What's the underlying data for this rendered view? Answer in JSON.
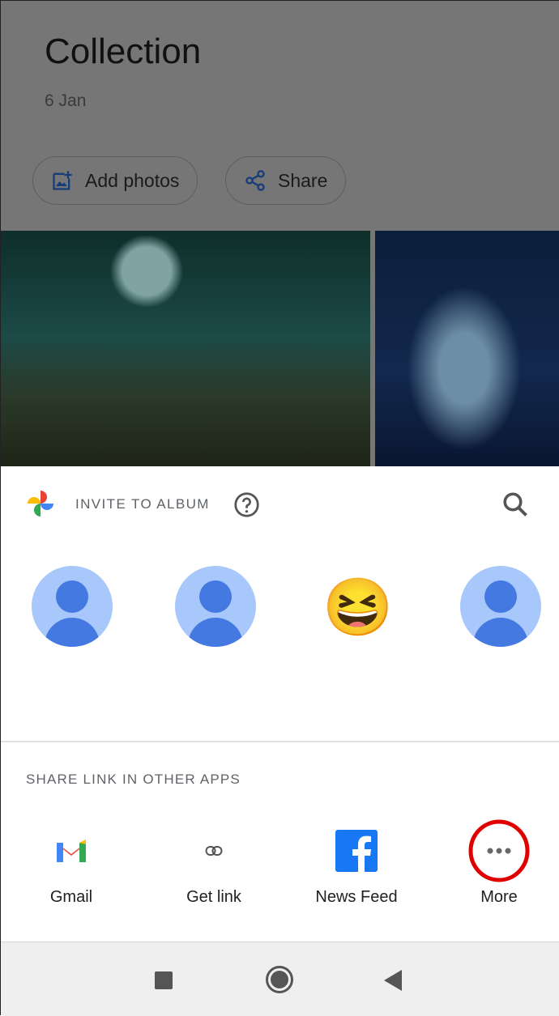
{
  "album": {
    "title": "Collection",
    "date": "6 Jan",
    "add_photos": "Add photos",
    "share": "Share"
  },
  "invite": {
    "label": "INVITE TO ALBUM",
    "help_icon": "help-circle-icon",
    "search_icon": "search-icon"
  },
  "contacts": [
    {
      "type": "default-avatar"
    },
    {
      "type": "default-avatar"
    },
    {
      "type": "emoji-avatar",
      "emoji": "😆"
    },
    {
      "type": "default-avatar"
    }
  ],
  "share_section": {
    "label": "SHARE LINK IN OTHER APPS",
    "apps": [
      {
        "label": "Gmail"
      },
      {
        "label": "Get link"
      },
      {
        "label": "News Feed"
      },
      {
        "label": "More"
      }
    ]
  },
  "colors": {
    "avatar_bg": "#a8c7fa",
    "avatar_fg": "#4479e1",
    "highlight": "#e00000",
    "facebook": "#1877f2"
  }
}
